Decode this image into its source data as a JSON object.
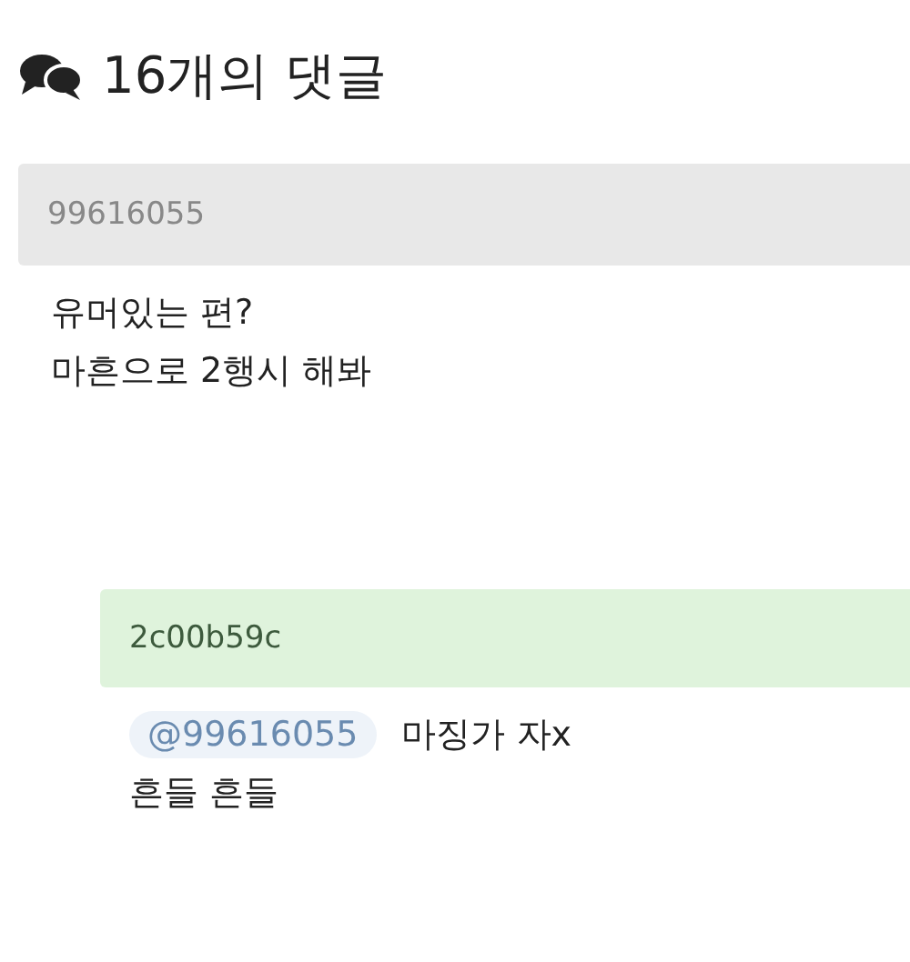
{
  "header": {
    "title": "16개의 댓글"
  },
  "comments": [
    {
      "kind": "comment",
      "author": "99616055",
      "lines": [
        "유머있는 편?",
        "마흔으로 2행시 해봐"
      ]
    },
    {
      "kind": "reply",
      "author": "2c00b59c",
      "mention": "@99616055",
      "lines": [
        "마징가 자x",
        "흔들 흔들"
      ]
    }
  ]
}
